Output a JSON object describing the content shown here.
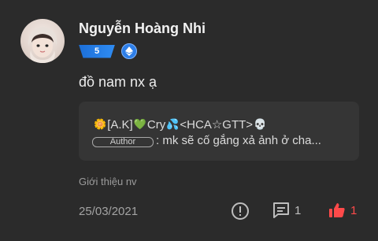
{
  "user": {
    "name": "Nguyễn Hoàng Nhi",
    "level": "5",
    "medal_icon": "ethereum-diamond-icon"
  },
  "comment": {
    "text": "đồ nam nx ạ"
  },
  "quote": {
    "author_name": "[A.K]",
    "author_name_2": "Cry",
    "author_name_3": "<HCA☆GTT>",
    "author_tag": "Author",
    "text": ": mk sẽ cố gắng xả ảnh ở cha..."
  },
  "topic": "Giới thiệu nv",
  "footer": {
    "date": "25/03/2021",
    "reply_count": "1",
    "like_count": "1"
  },
  "colors": {
    "background": "#2b2b2b",
    "quote_background": "#353535",
    "level_badge": "#2f8cf2",
    "like_active": "#ff4a4a"
  }
}
